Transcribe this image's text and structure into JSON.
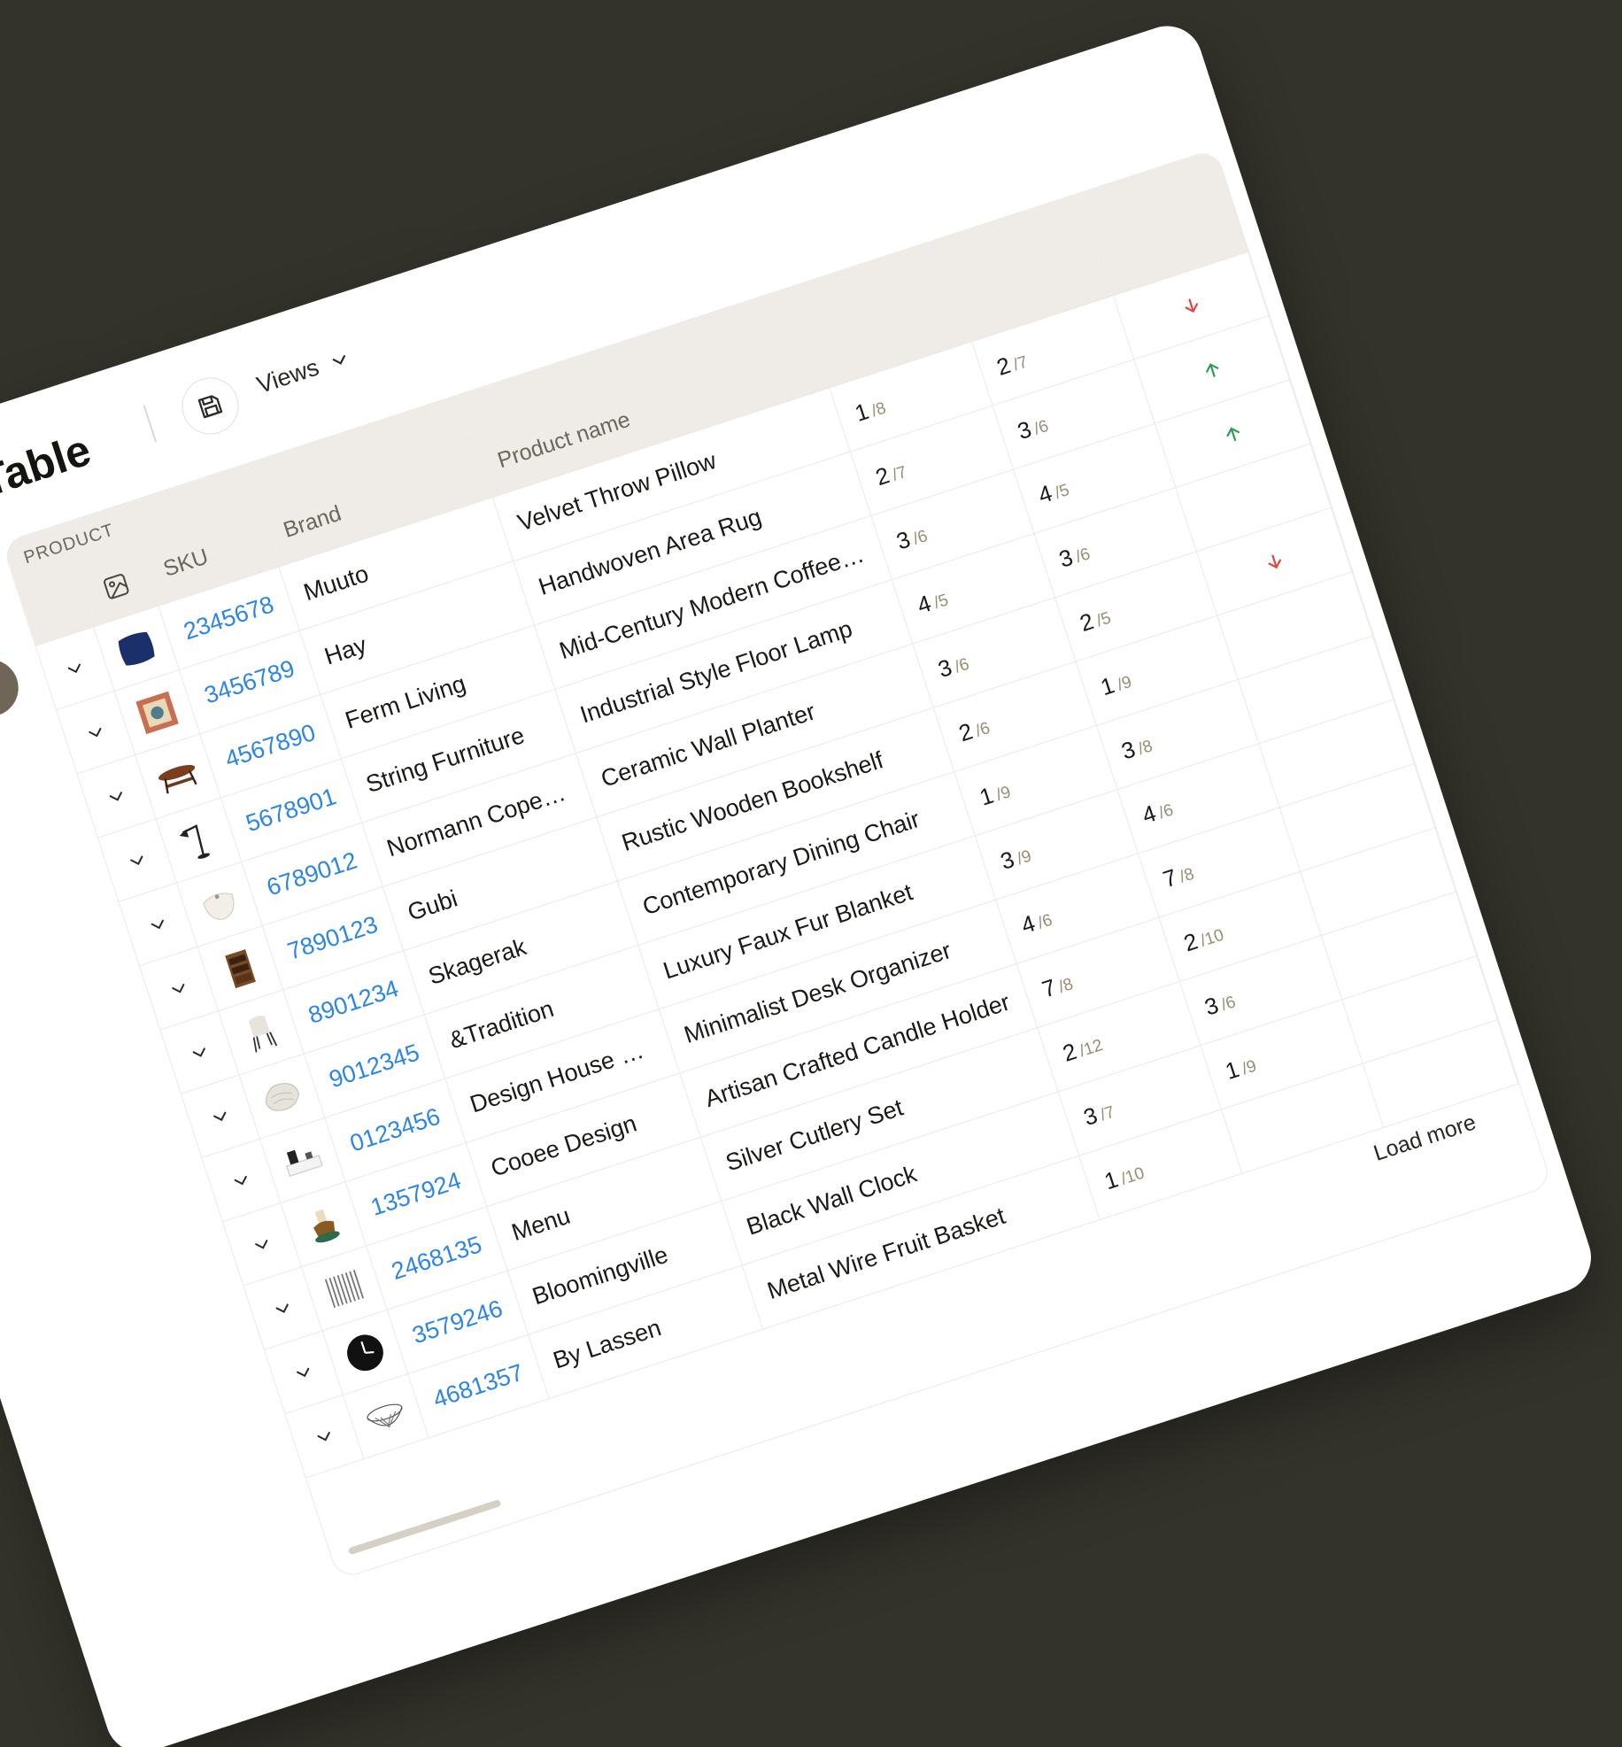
{
  "app": {
    "title": "Table",
    "views_label": "Views"
  },
  "table": {
    "group_label": "PRODUCT",
    "columns": {
      "sku": "SKU",
      "brand": "Brand",
      "product_name": "Product name"
    },
    "load_more_label": "Load more",
    "rows": [
      {
        "sku": "2345678",
        "brand": "Muuto",
        "name": "Velvet Throw Pillow",
        "r1": "1",
        "r1_of": "/8",
        "r2": "2",
        "r2_of": "/7",
        "trend": "down",
        "thumb": "pillow"
      },
      {
        "sku": "3456789",
        "brand": "Hay",
        "name": "Handwoven Area Rug",
        "r1": "2",
        "r1_of": "/7",
        "r2": "3",
        "r2_of": "/6",
        "trend": "up",
        "thumb": "rug"
      },
      {
        "sku": "4567890",
        "brand": "Ferm Living",
        "name": "Mid-Century Modern Coffee Table",
        "r1": "3",
        "r1_of": "/6",
        "r2": "4",
        "r2_of": "/5",
        "trend": "up",
        "thumb": "table"
      },
      {
        "sku": "5678901",
        "brand": "String Furniture",
        "name": "Industrial Style Floor Lamp",
        "r1": "4",
        "r1_of": "/5",
        "r2": "3",
        "r2_of": "/6",
        "trend": "",
        "thumb": "lamp"
      },
      {
        "sku": "6789012",
        "brand": "Normann Copenha...",
        "name": "Ceramic Wall Planter",
        "r1": "3",
        "r1_of": "/6",
        "r2": "2",
        "r2_of": "/5",
        "trend": "down",
        "thumb": "planter"
      },
      {
        "sku": "7890123",
        "brand": "Gubi",
        "name": "Rustic Wooden Bookshelf",
        "r1": "2",
        "r1_of": "/6",
        "r2": "1",
        "r2_of": "/9",
        "trend": "",
        "thumb": "bookshelf"
      },
      {
        "sku": "8901234",
        "brand": "Skagerak",
        "name": "Contemporary Dining Chair",
        "r1": "1",
        "r1_of": "/9",
        "r2": "3",
        "r2_of": "/8",
        "trend": "",
        "thumb": "chair"
      },
      {
        "sku": "9012345",
        "brand": "&Tradition",
        "name": "Luxury Faux Fur Blanket",
        "r1": "3",
        "r1_of": "/9",
        "r2": "4",
        "r2_of": "/6",
        "trend": "",
        "thumb": "blanket"
      },
      {
        "sku": "0123456",
        "brand": "Design House Sto...",
        "name": "Minimalist Desk Organizer",
        "r1": "4",
        "r1_of": "/6",
        "r2": "7",
        "r2_of": "/8",
        "trend": "",
        "thumb": "organizer"
      },
      {
        "sku": "1357924",
        "brand": "Cooee Design",
        "name": "Artisan Crafted Candle Holder",
        "r1": "7",
        "r1_of": "/8",
        "r2": "2",
        "r2_of": "/10",
        "trend": "",
        "thumb": "candle"
      },
      {
        "sku": "2468135",
        "brand": "Menu",
        "name": "Silver Cutlery Set",
        "r1": "2",
        "r1_of": "/12",
        "r2": "3",
        "r2_of": "/6",
        "trend": "",
        "thumb": "cutlery"
      },
      {
        "sku": "3579246",
        "brand": "Bloomingville",
        "name": "Black Wall Clock",
        "r1": "3",
        "r1_of": "/7",
        "r2": "1",
        "r2_of": "/9",
        "trend": "",
        "thumb": "clock"
      },
      {
        "sku": "4681357",
        "brand": "By Lassen",
        "name": "Metal Wire Fruit Basket",
        "r1": "1",
        "r1_of": "/10",
        "r2": "",
        "r2_of": "",
        "trend": "",
        "thumb": "basket"
      }
    ]
  },
  "colors": {
    "background": "#34332b",
    "header_bg": "#efebe6",
    "sku_link": "#2c86e8",
    "rank_of": "#9a8c75",
    "trend_up": "#2f9a5a",
    "trend_down": "#e0473e",
    "fab": "#6f6657"
  },
  "icons": {
    "save": "floppy-disk-icon",
    "views_caret": "chevron-down-icon",
    "image_column": "image-icon",
    "row_expand": "chevron-down-icon",
    "fab_1": "chevron-left-icon",
    "fab_2": "star-icon",
    "trend_up": "arrow-up-icon",
    "trend_down": "arrow-down-icon"
  }
}
